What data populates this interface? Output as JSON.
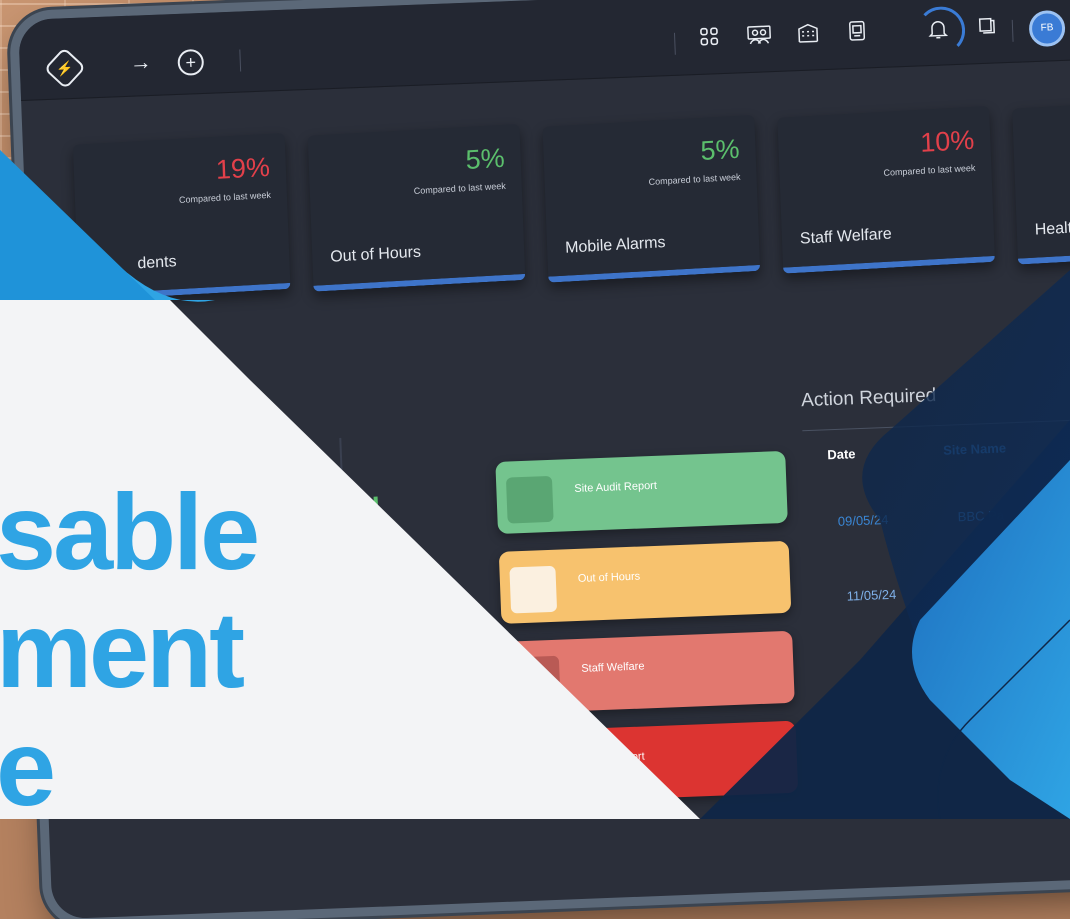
{
  "topbar": {
    "logo_glyph": "⚡",
    "arrow_glyph": "→",
    "plus_glyph": "+",
    "right_icons": [
      "grid-icon",
      "team-icon",
      "building-icon",
      "tablet-icon",
      "bell-icon",
      "book-icon"
    ],
    "avatar_initials": "FB"
  },
  "cards": [
    {
      "percent": "19%",
      "trend": "up",
      "compare_text": "Compared to last week",
      "name": "dents"
    },
    {
      "percent": "5%",
      "trend": "down",
      "compare_text": "Compared to last week",
      "name": "Out of Hours"
    },
    {
      "percent": "5%",
      "trend": "down",
      "compare_text": "Compared to last week",
      "name": "Mobile Alarms"
    },
    {
      "percent": "10%",
      "trend": "up",
      "compare_text": "Compared to last week",
      "name": "Staff Welfare"
    },
    {
      "percent": "",
      "trend": "",
      "compare_text": "",
      "name": "Healt"
    }
  ],
  "action_required": {
    "title": "Action Required",
    "headers": [
      "Date",
      "Site Name"
    ],
    "rows": [
      {
        "date": "09/05/24",
        "site": "BBC Pa"
      },
      {
        "date": "11/05/24",
        "site": ""
      }
    ]
  },
  "report_tiles": [
    {
      "label": "Site Audit Report",
      "color": "#74c48e",
      "square": "#5aa673"
    },
    {
      "label": "Out of Hours",
      "color": "#f7c26e",
      "square": "#fbf0e0"
    },
    {
      "label": "Staff Welfare",
      "color": "#e2786f",
      "square": "#b95a55"
    },
    {
      "label": "ident Report",
      "color": "#dc3431",
      "square": "#b8282a"
    }
  ],
  "headline": {
    "line1": "sable",
    "line2": "ment",
    "line3": "e"
  },
  "colors": {
    "accent_blue": "#2fa4e4",
    "trend_up": "#e2404a",
    "trend_down": "#5bbf6c"
  }
}
